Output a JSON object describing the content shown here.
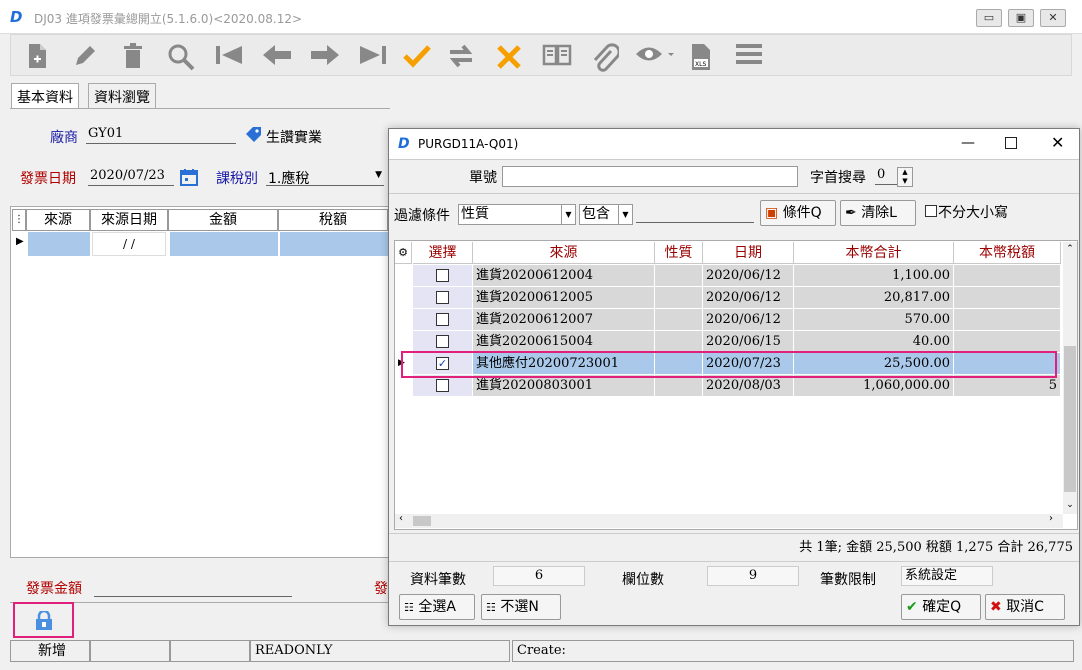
{
  "window": {
    "title": "DJ03 進項發票彙總開立(5.1.6.0)<2020.08.12>"
  },
  "tabs": [
    "基本資料",
    "資料瀏覽"
  ],
  "form": {
    "vendor_label": "廠商",
    "vendor_code": "GY01",
    "vendor_name": "生讚實業",
    "date_label": "發票日期",
    "date_value": "2020/07/23",
    "tax_label": "課稅別",
    "tax_value": "1.應稅",
    "amount_label": "發票金額",
    "amount_label2": "發"
  },
  "left_grid": {
    "columns": [
      "來源",
      "來源日期",
      "金額",
      "稅額"
    ],
    "date_placeholder": " / /"
  },
  "dialog": {
    "title": "PURGD11A-Q01)",
    "doc_label": "單號",
    "prefix_label": "字首搜尋",
    "prefix_value": "0",
    "filter_label": "過濾條件",
    "filter_field": "性質",
    "filter_op": "包含",
    "cond_button": "條件Q",
    "clear_button": "清除L",
    "ignore_case": "不分大小寫",
    "columns": [
      "選擇",
      "來源",
      "性質",
      "日期",
      "本幣合計",
      "本幣稅額"
    ],
    "rows": [
      {
        "checked": "",
        "source": "進貨20200612004",
        "nature": "",
        "date": "2020/06/12",
        "total": "1,100.00",
        "tax": ""
      },
      {
        "checked": "",
        "source": "進貨20200612005",
        "nature": "",
        "date": "2020/06/12",
        "total": "20,817.00",
        "tax": ""
      },
      {
        "checked": "",
        "source": "進貨20200612007",
        "nature": "",
        "date": "2020/06/12",
        "total": "570.00",
        "tax": ""
      },
      {
        "checked": "",
        "source": "進貨20200615004",
        "nature": "",
        "date": "2020/06/15",
        "total": "40.00",
        "tax": ""
      },
      {
        "checked": "✓",
        "source": "其他應付20200723001",
        "nature": "",
        "date": "2020/07/23",
        "total": "25,500.00",
        "tax": ""
      },
      {
        "checked": "",
        "source": "進貨20200803001",
        "nature": "",
        "date": "2020/08/03",
        "total": "1,060,000.00",
        "tax": "5"
      }
    ],
    "summary": "共 1筆; 金額 25,500 稅額 1,275 合計 26,775",
    "record_count_label": "資料筆數",
    "record_count": "6",
    "field_count_label": "欄位數",
    "field_count": "9",
    "limit_label": "筆數限制",
    "limit_value": "系統設定",
    "select_all": "全選A",
    "deselect": "不選N",
    "ok": "確定Q",
    "cancel": "取消C"
  },
  "status": {
    "mode": "新增",
    "state": "READONLY",
    "create": "Create:"
  },
  "accent": {
    "highlight_border": "#e0207a",
    "selected_row": "#a9c8ea",
    "red_label": "#b00000",
    "blue_label": "#1a1aa6"
  }
}
